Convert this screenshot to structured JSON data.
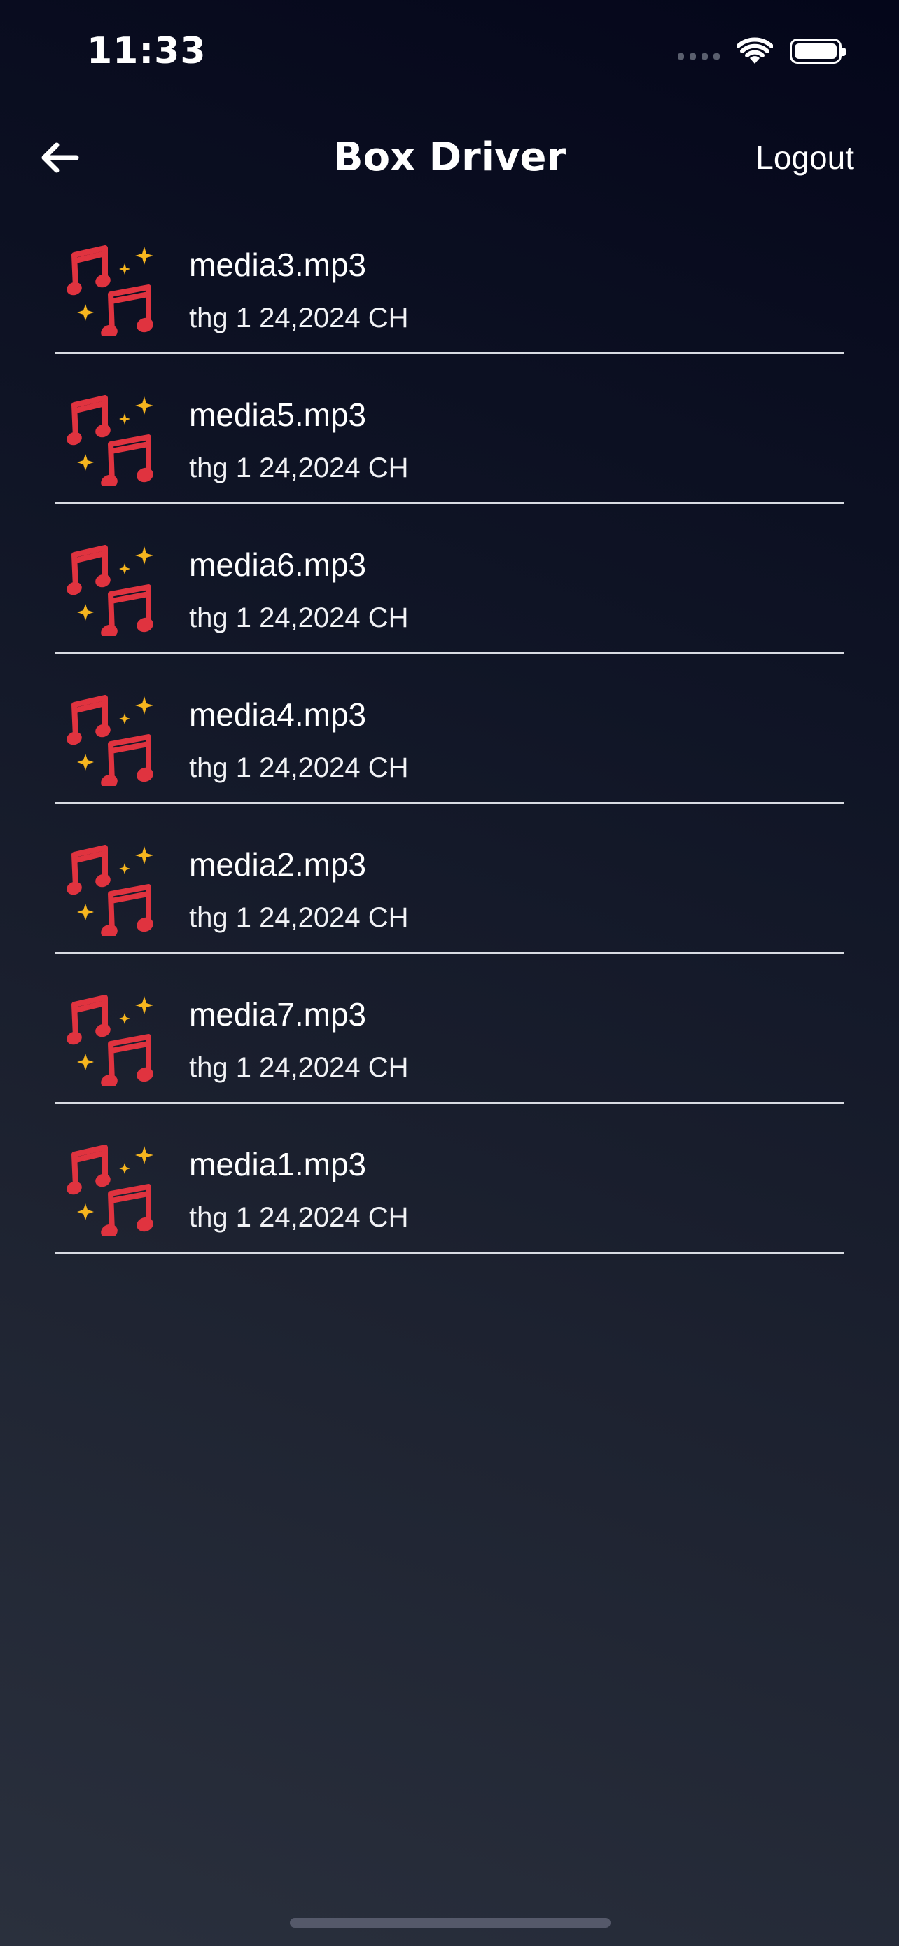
{
  "status_bar": {
    "time": "11:33",
    "signal_icon": "cellular-dots-icon",
    "wifi_icon": "wifi-icon",
    "battery_icon": "battery-icon"
  },
  "nav": {
    "back_icon": "arrow-left-icon",
    "title": "Box Driver",
    "logout_label": "Logout"
  },
  "files": [
    {
      "name": "media3.mp3",
      "date": "thg 1 24,2024 CH",
      "icon": "music-notes-icon"
    },
    {
      "name": "media5.mp3",
      "date": "thg 1 24,2024 CH",
      "icon": "music-notes-icon"
    },
    {
      "name": "media6.mp3",
      "date": "thg 1 24,2024 CH",
      "icon": "music-notes-icon"
    },
    {
      "name": "media4.mp3",
      "date": "thg 1 24,2024 CH",
      "icon": "music-notes-icon"
    },
    {
      "name": "media2.mp3",
      "date": "thg 1 24,2024 CH",
      "icon": "music-notes-icon"
    },
    {
      "name": "media7.mp3",
      "date": "thg 1 24,2024 CH",
      "icon": "music-notes-icon"
    },
    {
      "name": "media1.mp3",
      "date": "thg 1 24,2024 CH",
      "icon": "music-notes-icon"
    }
  ],
  "colors": {
    "note_red": "#e0333f",
    "sparkle_gold": "#f6b51e",
    "separator": "#d8dbe2",
    "background_top": "#04061a",
    "background_bottom": "#2a303d"
  }
}
